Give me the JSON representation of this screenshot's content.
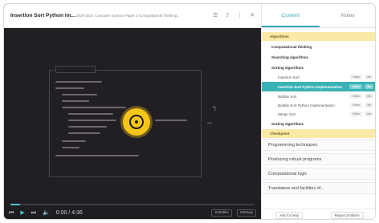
{
  "video": {
    "title": "Insertion Sort Python im...",
    "subtitle": "2020-2024 Computer Science Paper 2 Computational Thinking...",
    "top_icons": [
      "list-icon",
      "share-icon",
      "more-icon",
      "close-icon"
    ],
    "progress": 0.04,
    "time": "0:00 / 4:36",
    "right_buttons": [
      "Subtitles",
      "Settings"
    ]
  },
  "sidebar": {
    "tabs": [
      {
        "label": "Content",
        "active": true
      },
      {
        "label": "Notes",
        "active": false
      }
    ],
    "rows": [
      {
        "label": "Algorithms",
        "kind": "yellow"
      },
      {
        "label": "Computational thinking",
        "kind": "sub"
      },
      {
        "label": "Searching algorithms",
        "kind": "sub"
      },
      {
        "label": "Sorting algorithms",
        "kind": "sub"
      },
      {
        "label": "Insertion Sort",
        "kind": "item",
        "chip": "Video",
        "chip2": "4m"
      },
      {
        "label": "Insertion Sort Python Implementation",
        "kind": "active",
        "chip": "Video",
        "chip2": "4m"
      },
      {
        "label": "Bubble Sort",
        "kind": "item",
        "chip": "Video",
        "chip2": "5m"
      },
      {
        "label": "Bubble Sort Python Implementation",
        "kind": "item",
        "chip": "Video",
        "chip2": "3m"
      },
      {
        "label": "Merge Sort",
        "kind": "item",
        "chip": "Video",
        "chip2": "6m"
      },
      {
        "label": "Sorting algorithms",
        "kind": "sub"
      },
      {
        "label": "Checkpoint",
        "kind": "yellow"
      },
      {
        "label": "Programming techniques",
        "kind": "topic"
      },
      {
        "label": "Producing robust programs",
        "kind": "topic"
      },
      {
        "label": "Computational logic",
        "kind": "topic"
      },
      {
        "label": "Translators and facilities of...",
        "kind": "topic"
      }
    ],
    "actions": [
      "Ask for help",
      "Report problem"
    ]
  },
  "colors": {
    "accent": "#3bb3b6",
    "highlight": "#f5c518",
    "video_bg": "#221f24"
  }
}
